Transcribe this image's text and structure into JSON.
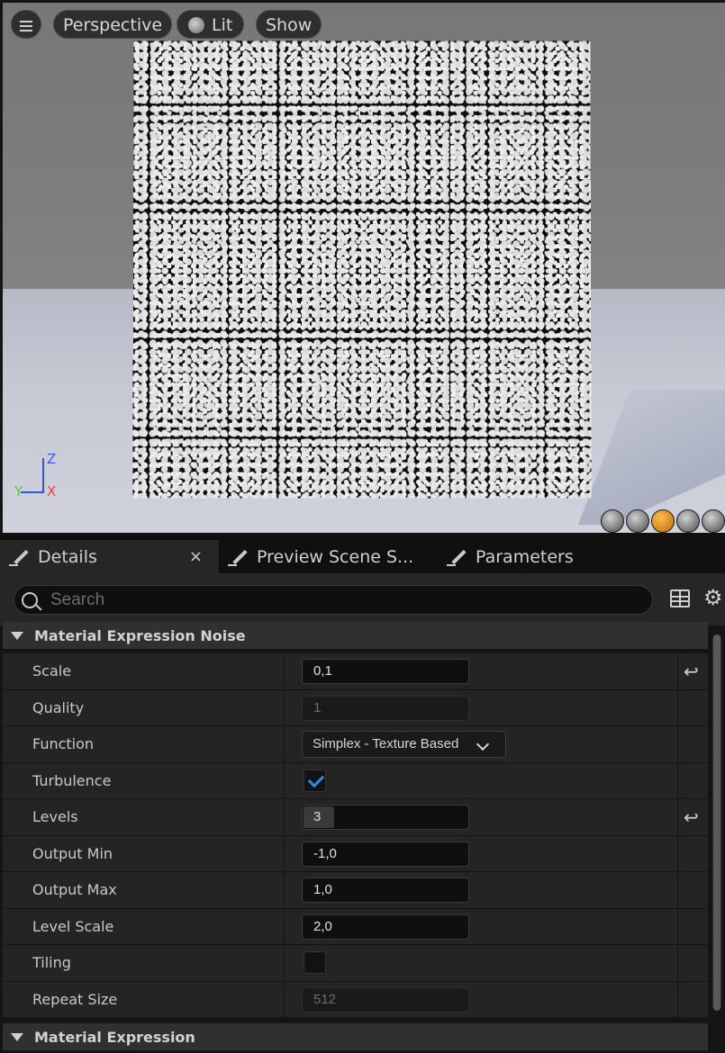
{
  "viewport": {
    "menu_icon": "hamburger-icon",
    "perspective_label": "Perspective",
    "lit_label": "Lit",
    "show_label": "Show",
    "axis": {
      "z": "Z",
      "x": "X",
      "y": "Y"
    },
    "preview_shapes": [
      "cylinder",
      "sphere",
      "plane",
      "cube",
      "mesh"
    ],
    "active_shape": "plane"
  },
  "tabs": [
    {
      "label": "Details",
      "icon": "pencil-icon",
      "active": true,
      "close": "×"
    },
    {
      "label": "Preview Scene S...",
      "icon": "pencil-icon"
    },
    {
      "label": "Parameters",
      "icon": "pencil-icon"
    }
  ],
  "search": {
    "placeholder": "Search"
  },
  "sections": {
    "noise": {
      "title": "Material Expression Noise"
    },
    "expression": {
      "title": "Material Expression"
    }
  },
  "properties": {
    "scale": {
      "label": "Scale",
      "value": "0,1"
    },
    "quality": {
      "label": "Quality",
      "value": "1"
    },
    "function": {
      "label": "Function",
      "value": "Simplex - Texture Based"
    },
    "turbulence": {
      "label": "Turbulence",
      "checked": true
    },
    "levels": {
      "label": "Levels",
      "value": "3"
    },
    "output_min": {
      "label": "Output Min",
      "value": "-1,0"
    },
    "output_max": {
      "label": "Output Max",
      "value": "1,0"
    },
    "level_scale": {
      "label": "Level Scale",
      "value": "2,0"
    },
    "tiling": {
      "label": "Tiling",
      "checked": false
    },
    "repeat_size": {
      "label": "Repeat Size",
      "value": "512"
    }
  },
  "colors": {
    "accent": "#2a8af2",
    "active_shape": "#e08a1e"
  }
}
